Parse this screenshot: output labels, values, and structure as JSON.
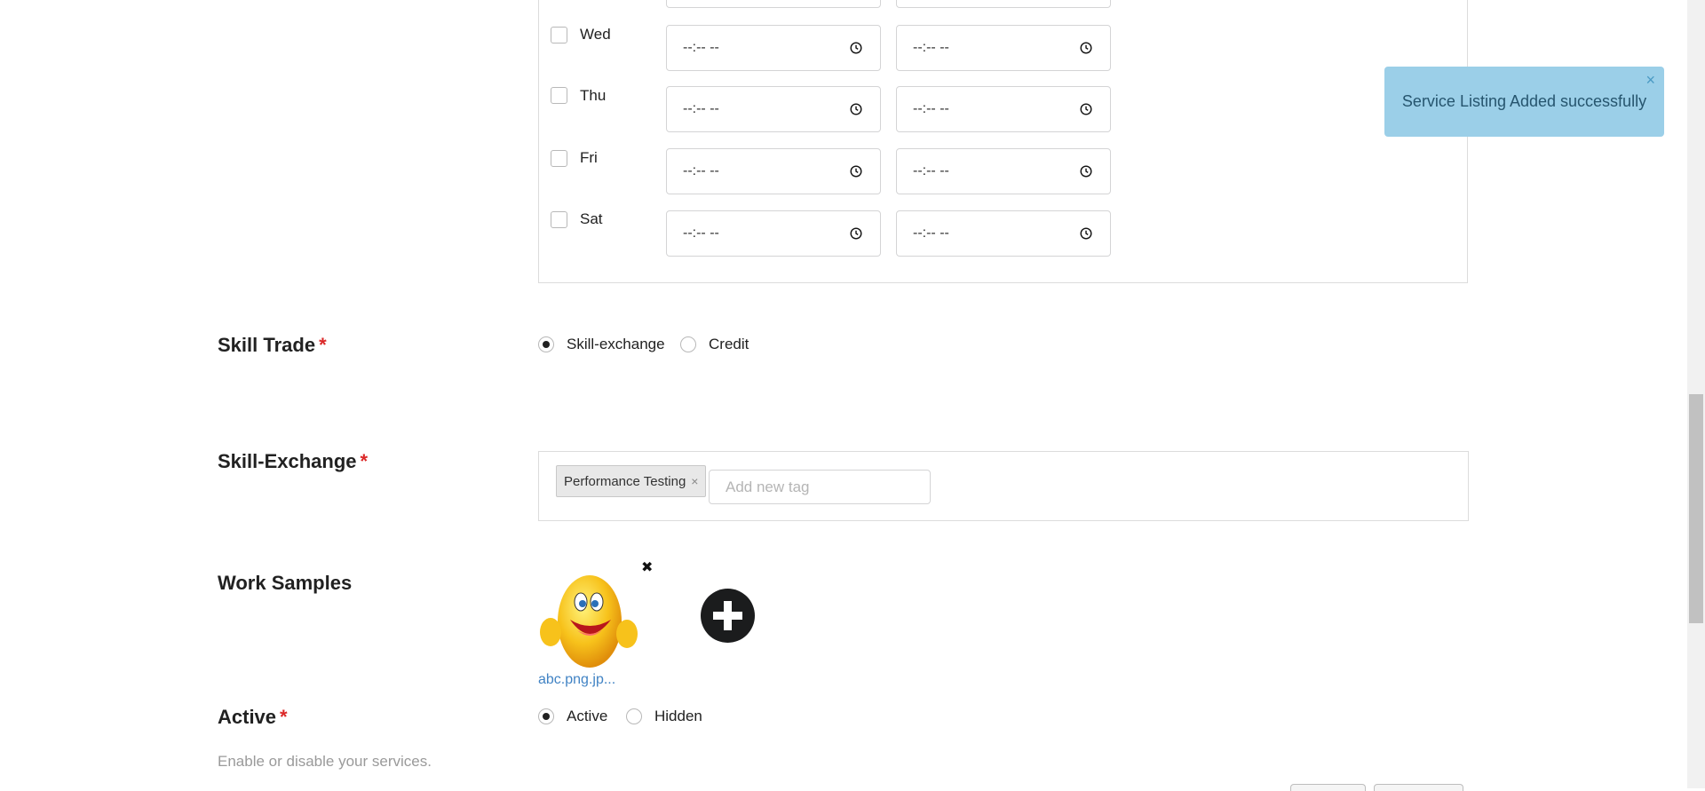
{
  "availability": {
    "days": [
      {
        "label": "Wed",
        "checked": false,
        "start_placeholder": "--:-- --",
        "end_placeholder": "--:-- --"
      },
      {
        "label": "Thu",
        "checked": false,
        "start_placeholder": "--:-- --",
        "end_placeholder": "--:-- --"
      },
      {
        "label": "Fri",
        "checked": false,
        "start_placeholder": "--:-- --",
        "end_placeholder": "--:-- --"
      },
      {
        "label": "Sat",
        "checked": false,
        "start_placeholder": "--:-- --",
        "end_placeholder": "--:-- --"
      }
    ]
  },
  "skill_trade": {
    "label": "Skill Trade",
    "required_mark": "*",
    "options": [
      {
        "label": "Skill-exchange",
        "selected": true
      },
      {
        "label": "Credit",
        "selected": false
      }
    ]
  },
  "skill_exchange": {
    "label": "Skill-Exchange",
    "required_mark": "*",
    "tags": [
      "Performance Testing"
    ],
    "tag_remove": "×",
    "input_placeholder": "Add new tag"
  },
  "work_samples": {
    "label": "Work Samples",
    "files": [
      {
        "name": "abc.png.jp...",
        "remove": "✖"
      }
    ]
  },
  "active": {
    "label": "Active",
    "required_mark": "*",
    "hint": "Enable or disable your services.",
    "options": [
      {
        "label": "Active",
        "selected": true
      },
      {
        "label": "Hidden",
        "selected": false
      }
    ]
  },
  "toast": {
    "message": "Service Listing Added successfully",
    "close": "×"
  },
  "colors": {
    "toast_bg": "#9bcfe8",
    "required": "#db2828",
    "link": "#4183c4"
  }
}
